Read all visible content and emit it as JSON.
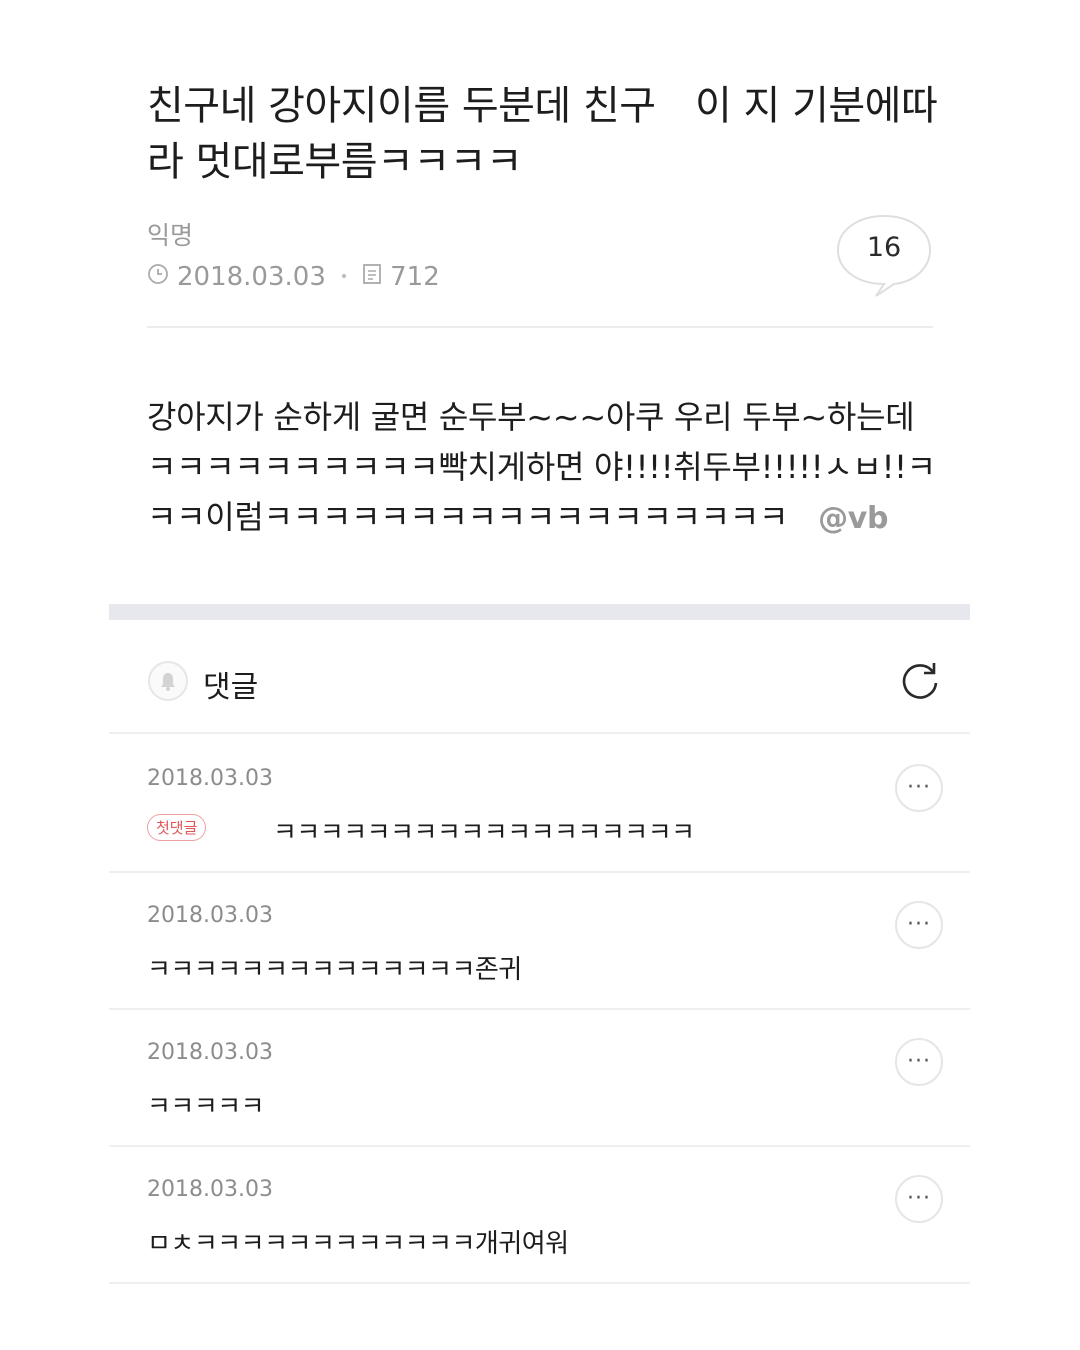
{
  "post": {
    "title": "친구네 강아지이름 두분데 친구　이 지 기분에따라 멋대로부름ㅋㅋㅋㅋ",
    "author": "익명",
    "date": "2018.03.03",
    "views": "712",
    "comment_count": "16",
    "body": "강아지가 순하게 굴면 순두부~~~아쿠 우리 두부~하는데ㅋㅋㅋㅋㅋㅋㅋㅋㅋㅋ빡치게하면 야!!!!취두부!!!!!ㅅㅂ!!ㅋㅋㅋ이럼ㅋㅋㅋㅋㅋㅋㅋㅋㅋㅋㅋㅋㅋㅋㅋㅋㅋㅋ",
    "watermark": "@vb"
  },
  "comments_section": {
    "label": "댓글"
  },
  "comments": [
    {
      "date": "2018.03.03",
      "badge": "첫댓글",
      "text": "ㅋㅋㅋㅋㅋㅋㅋㅋㅋㅋㅋㅋㅋㅋㅋㅋㅋㅋ",
      "more": "···"
    },
    {
      "date": "2018.03.03",
      "text": "ㅋㅋㅋㅋㅋㅋㅋㅋㅋㅋㅋㅋㅋㅋ존귀",
      "more": "···"
    },
    {
      "date": "2018.03.03",
      "text": "ㅋㅋㅋㅋㅋ",
      "more": "···"
    },
    {
      "date": "2018.03.03",
      "text": "ㅁㅊㅋㅋㅋㅋㅋㅋㅋㅋㅋㅋㅋㅋ개귀여워",
      "more": "···"
    }
  ],
  "icons": {
    "clock": "clock-icon",
    "views": "document-icon",
    "comment_bubble": "speech-bubble-icon",
    "bell": "bell-icon",
    "refresh": "refresh-icon",
    "more": "more-dots-icon"
  },
  "colors": {
    "badge": "#e05555",
    "band": "#e6e8ee",
    "muted": "#9a9a9a"
  }
}
